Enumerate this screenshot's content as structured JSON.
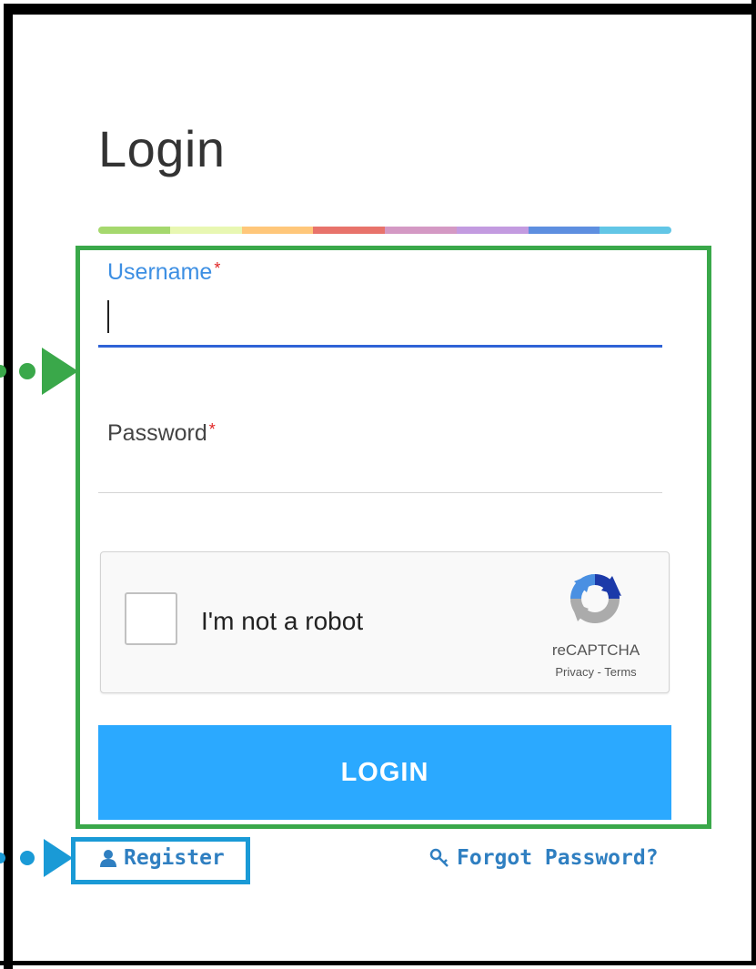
{
  "page": {
    "title": "Login"
  },
  "accent_colors": [
    "#a5d86d",
    "#e8f7b2",
    "#ffc77a",
    "#e8736b",
    "#d499c4",
    "#c39be0",
    "#5e8fe0",
    "#62c6e6"
  ],
  "form": {
    "username_label": "Username",
    "password_label": "Password",
    "required_marker": "*",
    "username_value": "",
    "password_value": ""
  },
  "recaptcha": {
    "label": "I'm not a robot",
    "brand": "reCAPTCHA",
    "links": "Privacy - Terms",
    "icon": "recaptcha-logo"
  },
  "actions": {
    "login_label": "LOGIN",
    "register_label": "Register",
    "register_icon": "user-icon",
    "forgot_label": "Forgot Password?",
    "forgot_icon": "key-icon"
  },
  "annotation_colors": {
    "form_highlight": "#3aa84a",
    "register_highlight": "#1a9ad6"
  }
}
